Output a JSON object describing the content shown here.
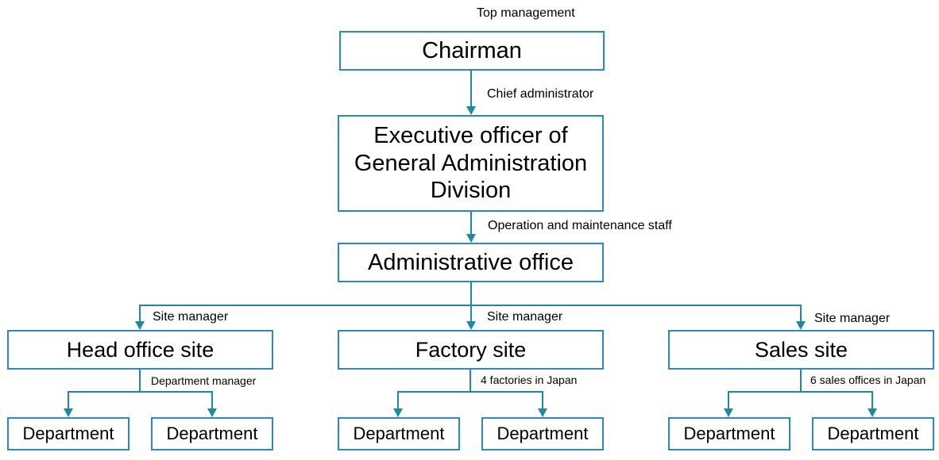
{
  "colors": {
    "box_border": "#2b88c8",
    "connector": "#1b8aa3"
  },
  "nodes": {
    "chairman": "Chairman",
    "executive": "Executive officer of General Administration Division",
    "admin_office": "Administrative office",
    "head_office": "Head office site",
    "factory": "Factory site",
    "sales": "Sales site",
    "department": "Department"
  },
  "labels": {
    "top_management": "Top management",
    "chief_administrator": "Chief administrator",
    "operation_staff": "Operation and maintenance staff",
    "site_manager": "Site manager",
    "department_manager": "Department manager",
    "factories": "4 factories in Japan",
    "sales_offices": "6 sales offices in Japan"
  }
}
